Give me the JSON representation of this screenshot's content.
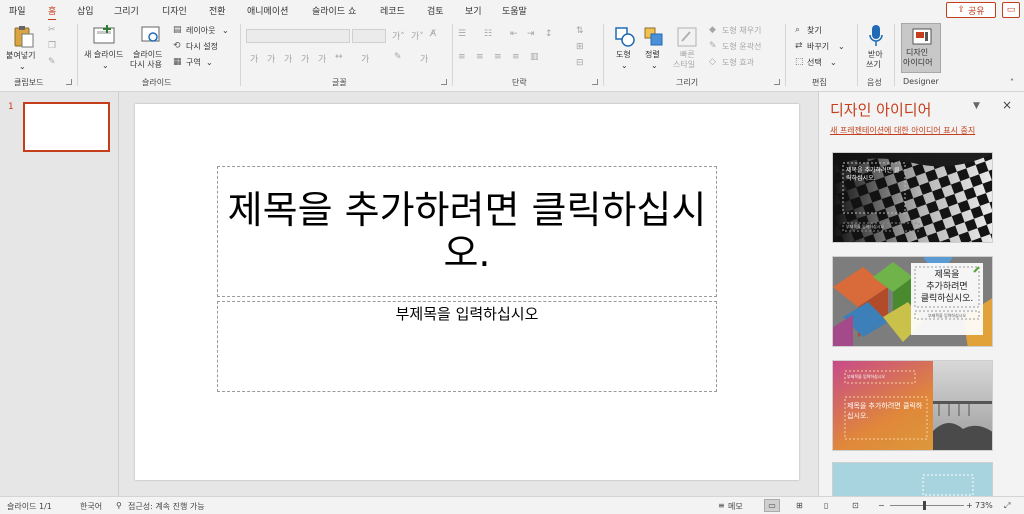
{
  "tabs": [
    "파일",
    "홈",
    "삽입",
    "그리기",
    "디자인",
    "전환",
    "애니메이션",
    "슬라이드 쇼",
    "레코드",
    "검토",
    "보기",
    "도움말"
  ],
  "active_tab": "홈",
  "share_label": "공유",
  "ribbon": {
    "clipboard": {
      "label": "클립보드",
      "paste": "붙여넣기"
    },
    "slides": {
      "label": "슬라이드",
      "new_slide": "새 슬라이드",
      "reuse_1": "슬라이드",
      "reuse_2": "다시 사용",
      "layout": "레이아웃",
      "reset": "다시 설정",
      "section": "구역"
    },
    "font": {
      "label": "글꼴"
    },
    "paragraph": {
      "label": "단락"
    },
    "drawing": {
      "label": "그리기",
      "shapes": "도형",
      "arrange": "정렬",
      "quick_1": "빠른",
      "quick_2": "스타일",
      "fill": "도형 채우기",
      "outline": "도형 윤곽선",
      "effects": "도형 효과"
    },
    "editing": {
      "label": "편집",
      "find": "찾기",
      "replace": "바꾸기",
      "select": "선택"
    },
    "voice": {
      "label": "음성",
      "dictate_1": "받아",
      "dictate_2": "쓰기"
    },
    "designer": {
      "label": "Designer",
      "btn_1": "디자인",
      "btn_2": "아이디어"
    }
  },
  "slide_number": "1",
  "slide": {
    "title": "제목을 추가하려면 클릭하십시오.",
    "subtitle": "부제목을 입력하십시오"
  },
  "designer_pane": {
    "title": "디자인 아이디어",
    "stop_link": "새 프레젠테이션에 대한 아이디어 표시 중지",
    "idea_title": "제목을 추가하려면 클릭하십시오.",
    "idea_title_short_1": "제목을",
    "idea_title_short_2": "추가하려면",
    "idea_title_short_3": "클릭하십시오.",
    "idea_subtitle": "부제목을 입력하십시오"
  },
  "status": {
    "slide_counter": "슬라이드 1/1",
    "language": "한국어",
    "accessibility": "접근성: 계속 진행 가능",
    "notes": "메모",
    "zoom": "73%"
  },
  "colors": {
    "accent": "#c43e1c"
  }
}
